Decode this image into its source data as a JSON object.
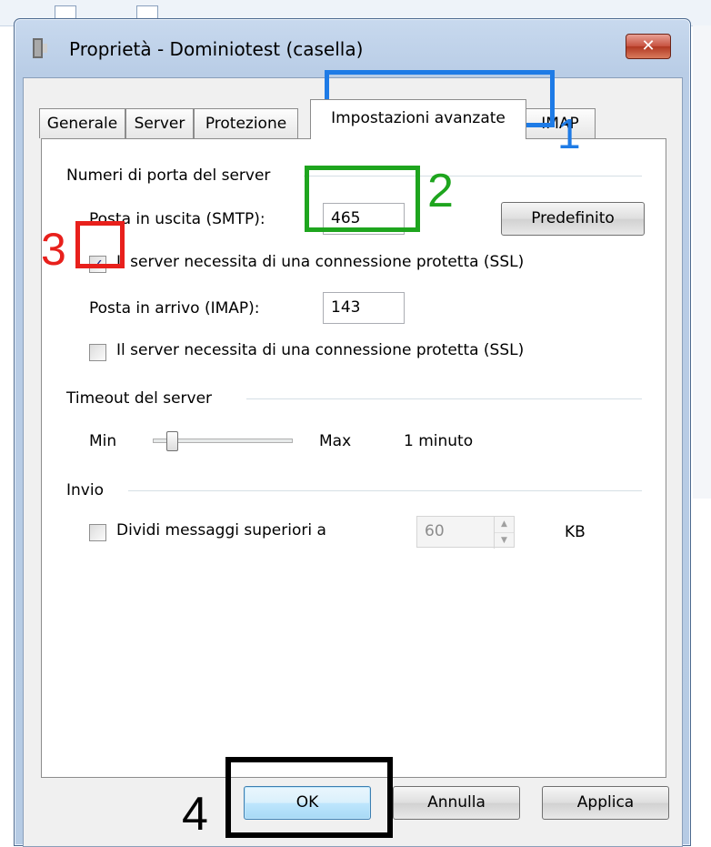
{
  "window": {
    "title": "Proprietà - Dominiotest (casella)",
    "close_symbol": "✕"
  },
  "tabs": [
    {
      "label": "Generale",
      "active": false
    },
    {
      "label": "Server",
      "active": false
    },
    {
      "label": "Protezione",
      "active": false
    },
    {
      "label": "Impostazioni avanzate",
      "active": true
    },
    {
      "label": "IMAP",
      "active": false
    }
  ],
  "ports": {
    "group_label": "Numeri di porta del server",
    "smtp_label": "Posta in uscita (SMTP):",
    "smtp_value": "465",
    "default_button": "Predefinito",
    "smtp_ssl_label": "Il server necessita di una connessione protetta (SSL)",
    "smtp_ssl_checked": true,
    "imap_label": "Posta in arrivo (IMAP):",
    "imap_value": "143",
    "imap_ssl_label": "Il server necessita di una connessione protetta (SSL)",
    "imap_ssl_checked": false
  },
  "timeout": {
    "group_label": "Timeout del server",
    "min_label": "Min",
    "max_label": "Max",
    "value_text": "1 minuto",
    "slider_fraction": 0.1
  },
  "sending": {
    "group_label": "Invio",
    "split_label": "Dividi messaggi superiori a",
    "split_checked": false,
    "size_value": "60",
    "unit": "KB"
  },
  "buttons": {
    "ok": "OK",
    "cancel": "Annulla",
    "apply": "Applica"
  },
  "annotations": [
    {
      "number": "1",
      "color": "#1e7be6"
    },
    {
      "number": "2",
      "color": "#1ea51e"
    },
    {
      "number": "3",
      "color": "#e8201c"
    },
    {
      "number": "4",
      "color": "#000000"
    }
  ]
}
